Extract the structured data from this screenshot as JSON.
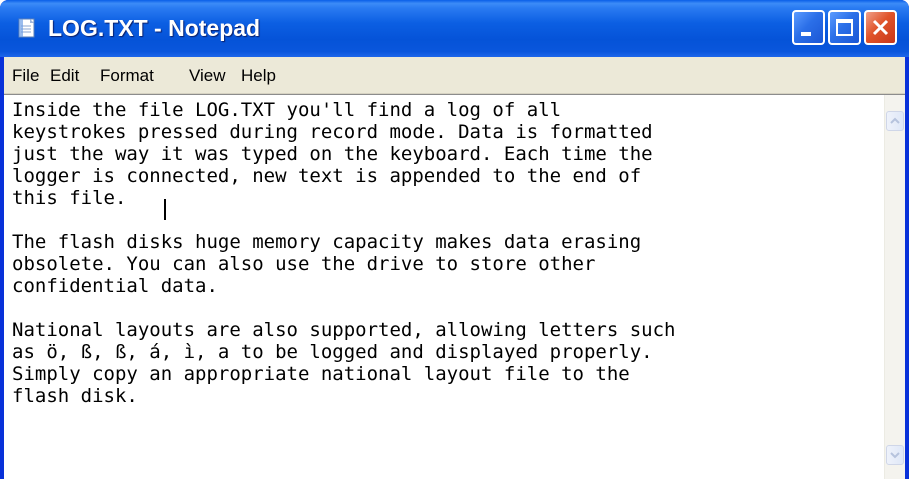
{
  "window": {
    "title": "LOG.TXT - Notepad"
  },
  "icons": {
    "app": "notepad-icon",
    "minimize": "minimize-icon",
    "maximize": "maximize-icon",
    "close": "close-icon",
    "scroll_up": "scroll-up-arrow-icon",
    "scroll_down": "scroll-down-arrow-icon"
  },
  "menu": {
    "items": [
      {
        "label": "File"
      },
      {
        "label": "Edit"
      },
      {
        "label": "Format"
      },
      {
        "label": "View"
      },
      {
        "label": "Help"
      }
    ]
  },
  "editor": {
    "content": "Inside the file LOG.TXT you'll find a log of all\nkeystrokes pressed during record mode. Data is formatted\njust the way it was typed on the keyboard. Each time the\nlogger is connected, new text is appended to the end of\nthis file.\n\nThe flash disks huge memory capacity makes data erasing\nobsolete. You can also use the drive to store other\nconfidential data.\n\nNational layouts are also supported, allowing letters such\nas ö, ß, ß, á, ì, a to be logged and displayed properly.\nSimply copy an appropriate national layout file to the\nflash disk."
  },
  "colors": {
    "titlebar": "#0553d8",
    "title_text": "#ffffff",
    "menubar": "#ece9d8",
    "close_button": "#e0542a",
    "editor_background": "#ffffff"
  }
}
